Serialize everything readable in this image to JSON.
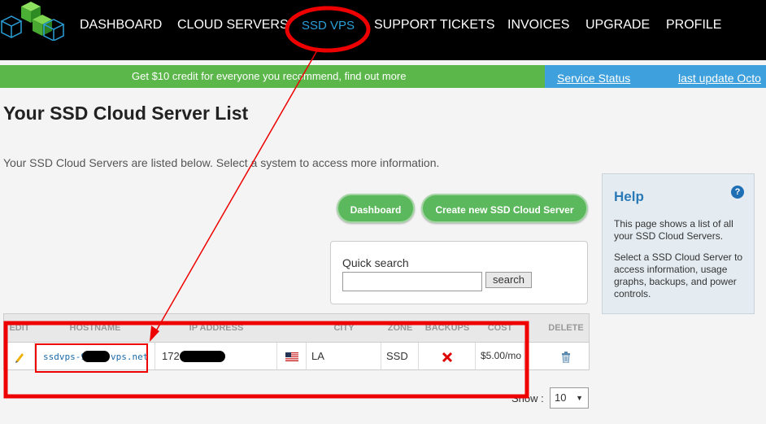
{
  "nav": {
    "items": [
      {
        "label": "DASHBOARD"
      },
      {
        "label": "CLOUD SERVERS"
      },
      {
        "label": "SSD VPS"
      },
      {
        "label": "SUPPORT TICKETS"
      },
      {
        "label": "INVOICES"
      },
      {
        "label": "UPGRADE"
      },
      {
        "label": "PROFILE"
      }
    ],
    "active_color": "#2a9fd8"
  },
  "banner": {
    "referral_text": "Get $10 credit for everyone you recommend, find out more",
    "service_status": "Service Status",
    "last_update": "last update Octo"
  },
  "page": {
    "title": "Your SSD Cloud Server List",
    "intro": "Your SSD Cloud Servers are listed below. Select a system to access more information."
  },
  "buttons": {
    "dashboard": "Dashboard",
    "create": "Create new SSD Cloud Server"
  },
  "search": {
    "label": "Quick search",
    "value": "",
    "button": "search"
  },
  "help": {
    "title": "Help",
    "icon": "question-icon",
    "p1": "This page shows a list of all your SSD Cloud Servers.",
    "p2": "Select a SSD Cloud Server to access information, usage graphs, backups, and power controls."
  },
  "table": {
    "headers": [
      "EDIT",
      "HOSTNAME",
      "IP ADDRESS",
      "",
      "CITY",
      "ZONE",
      "BACKUPS",
      "COST",
      "DELETE"
    ],
    "rows": [
      {
        "hostname_start": "ssdvps-9",
        "hostname_end": "vps.net",
        "ip_start": "172",
        "city": "LA",
        "zone": "SSD",
        "cost": "$5.00/mo"
      }
    ]
  },
  "pager": {
    "show_label": "Show :",
    "value": "10"
  },
  "colors": {
    "nav_bg": "#000000",
    "green": "#5bb749",
    "blue": "#3ea0dc",
    "annotation": "#ee0000"
  }
}
